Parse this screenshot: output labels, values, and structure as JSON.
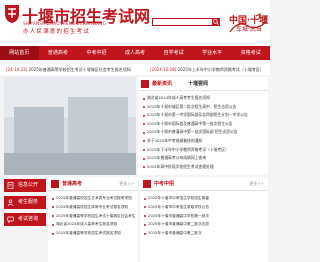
{
  "header": {
    "title": "十堰市招生考试网",
    "pinyin": "SHIYANSHIZHAOSHENGKAOSHIWANG",
    "slogan": "办人民满意的招生考试",
    "brand_line1": "中国·十堰",
    "brand_line2": "车城·武当"
  },
  "nav": {
    "items": [
      {
        "label": "网站首页",
        "active": true
      },
      {
        "label": "普通高考",
        "active": false
      },
      {
        "label": "中考中招",
        "active": false
      },
      {
        "label": "成人高考",
        "active": false
      },
      {
        "label": "自学考试",
        "active": false
      },
      {
        "label": "学业水平",
        "active": false
      },
      {
        "label": "资格考试",
        "active": false
      }
    ]
  },
  "ticker": {
    "items": [
      {
        "date": "[24-10-23]",
        "text": "2025年普通高等学校招生考试十堰城区社会考生报名须知"
      },
      {
        "date": "[2024-12-28]",
        "text": "2025年上半年中小学教师资格考试（十堰考区）"
      }
    ]
  },
  "news": {
    "tabs": [
      "最新资讯",
      "十堰要闻"
    ],
    "items": [
      "湖北省2024年成人高考考生报名须知",
      "2025年十堰市城区第二批次招生高中、招生志愿公告",
      "2025年十堰市第一中学国际部及北四部招生计划一中学公告",
      "2025年十堰市国际部及普通高中第一批次招生公告",
      "2025年十堰市普通高中第一批次国际部 招生志愿公告",
      "关于2025年中考成绩复核的通知",
      "2025年下半年中小学教师资格考试（十堰考区）",
      "2025年普通高考公布成绩网上查询",
      "2025年高中阶段学校招生考试违规处理"
    ]
  },
  "sidebar": {
    "buttons": [
      "信息公开",
      "考生服务",
      "考试咨询"
    ]
  },
  "gaokao": {
    "title": "普通高考",
    "more": "更多>>",
    "items": [
      "2025年普通高校招生艺术类专业考试报考须知",
      "2025年普通高校招生体育专业考试报名须知",
      "2025年普通高等学校招生考试十堰城区社会考生...",
      "湖北省2024年成人高考考生报名须知",
      "2025年普通高等学校招生考试报名须知"
    ]
  },
  "zhongkao": {
    "title": "中考中招",
    "more": "更多>>",
    "items": [
      "2025年十堰市中考招生学校招生简章",
      "2025年十堰市中考招生录取学校公告",
      "2025年十堰市普通高中学校第一批次",
      "2025年十堰市普通高中第二批次志愿",
      "2025年十堰市普通高中第二批次"
    ]
  },
  "colors": {
    "brand_red": "#c0151c",
    "nav_active": "#9e0d13",
    "background": "#f4f4f4"
  }
}
